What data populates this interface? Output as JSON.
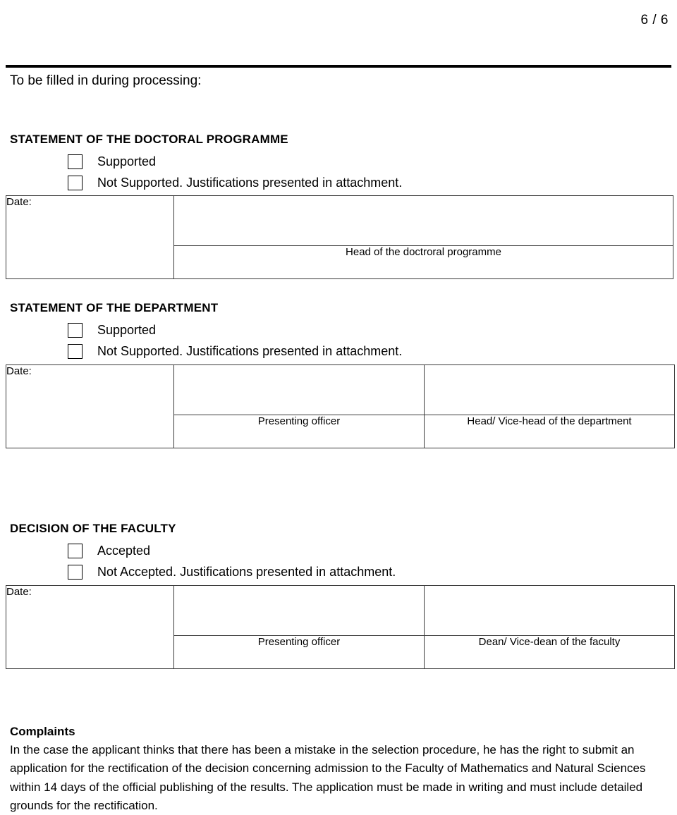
{
  "document": {
    "page_number": "6 / 6",
    "intro_line": "To be filled in during processing:"
  },
  "sections": [
    {
      "title": "STATEMENT OF THE DOCTORAL PROGRAMME",
      "options": [
        "Supported",
        "Not Supported. Justifications presented in attachment."
      ],
      "table": {
        "date_label": "Date:",
        "signature_labels": [
          "Head of the doctroral programme"
        ]
      }
    },
    {
      "title": "STATEMENT OF THE DEPARTMENT",
      "options": [
        "Supported",
        "Not Supported. Justifications presented in attachment."
      ],
      "table": {
        "date_label": "Date:",
        "signature_labels": [
          "Presenting officer",
          "Head/ Vice-head of the department"
        ]
      }
    },
    {
      "title": "DECISION OF THE FACULTY",
      "options": [
        "Accepted",
        "Not Accepted. Justifications presented in attachment."
      ],
      "table": {
        "date_label": "Date:",
        "signature_labels": [
          "Presenting officer",
          "Dean/ Vice-dean of the faculty"
        ]
      }
    }
  ],
  "complaints": {
    "title": "Complaints",
    "body": "In the case the applicant thinks that there has been a mistake in the selection procedure, he has the right to submit an application for the rectification of the decision concerning admission to the Faculty of Mathematics and Natural Sciences within 14 days of the official publishing of the results. The application must be made in writing and must include detailed grounds for the rectification."
  }
}
